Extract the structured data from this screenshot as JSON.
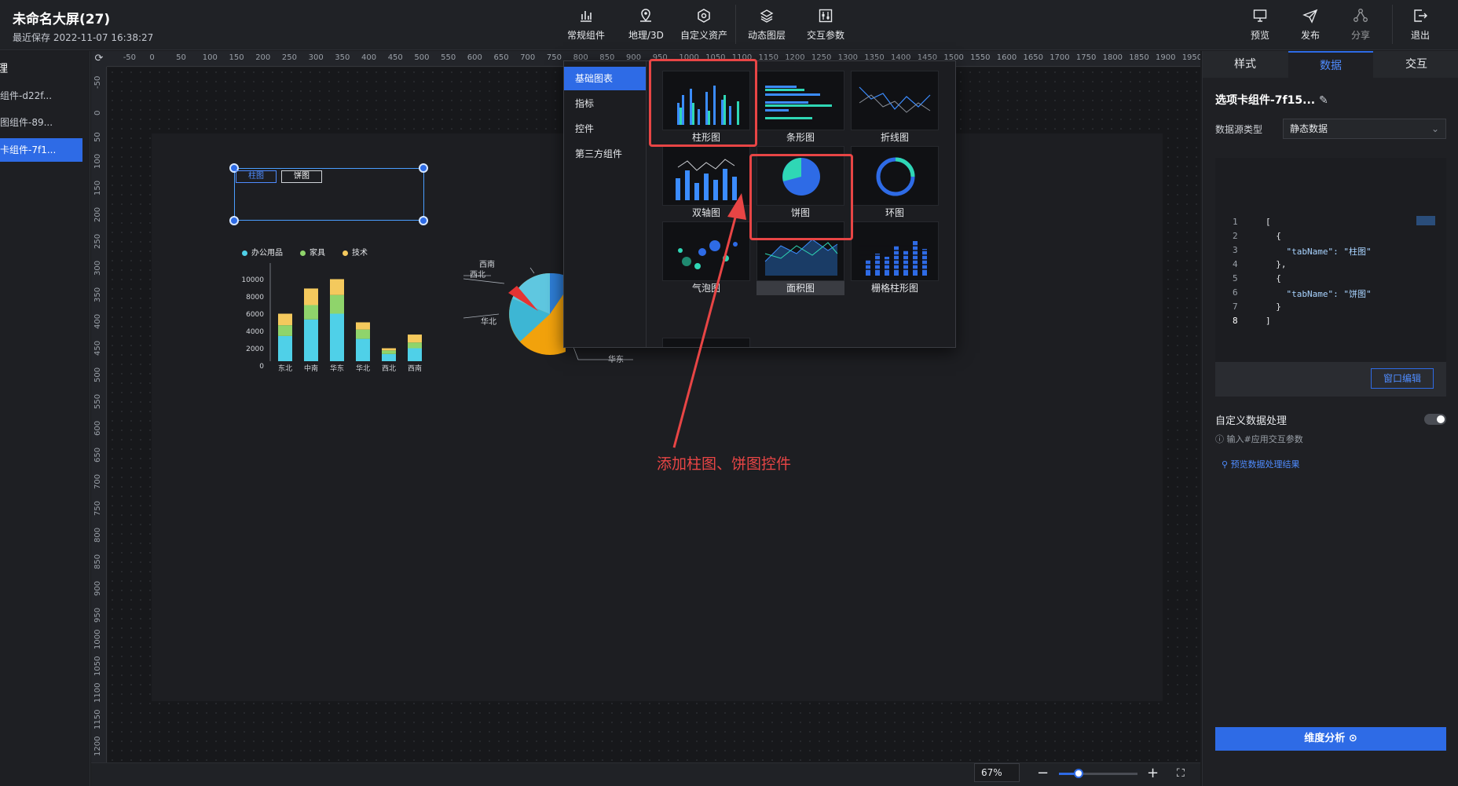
{
  "header": {
    "title": "未命名大屏(27)",
    "subtitle": "最近保存 2022-11-07 16:38:27",
    "tools": [
      {
        "label": "常规组件",
        "icon": "bar-chart-icon"
      },
      {
        "label": "地理/3D",
        "icon": "map-pin-icon"
      },
      {
        "label": "自定义资产",
        "icon": "hexagon-icon"
      },
      {
        "label": "动态图层",
        "icon": "layers-icon"
      },
      {
        "label": "交互参数",
        "icon": "sliders-icon"
      }
    ],
    "actions": [
      {
        "label": "预览",
        "icon": "monitor-icon"
      },
      {
        "label": "发布",
        "icon": "send-icon"
      },
      {
        "label": "分享",
        "icon": "share-icon"
      },
      {
        "label": "退出",
        "icon": "exit-icon"
      }
    ]
  },
  "layers": {
    "title": "理",
    "items": [
      "组件-d22f...",
      "图组件-89...",
      "卡组件-7f1..."
    ],
    "active_index": 2
  },
  "ruler": {
    "top": [
      "0",
      "-50",
      "0",
      "50",
      "100",
      "150",
      "200",
      "250",
      "300",
      "350",
      "400",
      "450",
      "500",
      "550",
      "600",
      "650",
      "700",
      "750",
      "800",
      "850",
      "900",
      "950",
      "1000",
      "1050",
      "1100",
      "1150",
      "1200",
      "1250",
      "1300",
      "1350",
      "1400",
      "1450",
      "1500",
      "1550",
      "1600",
      "1650",
      "1700",
      "1750",
      "1800",
      "1850",
      "1900",
      "1950"
    ],
    "left": [
      "-50",
      "0",
      "50",
      "100",
      "150",
      "200",
      "250",
      "300",
      "350",
      "400",
      "450",
      "500",
      "550",
      "600",
      "650",
      "700",
      "750",
      "800",
      "850",
      "900",
      "950",
      "1000",
      "1050",
      "1100",
      "1150",
      "1200"
    ]
  },
  "canvas": {
    "tabs": [
      "柱图",
      "饼图"
    ],
    "bar_chart": {
      "legend": [
        "办公用品",
        "家具",
        "技术"
      ],
      "y_ticks": [
        "10000",
        "8000",
        "6000",
        "4000",
        "2000",
        "0"
      ],
      "colors": [
        "#4fd0e8",
        "#8fd46b",
        "#f4c95d"
      ]
    },
    "pie_labels": [
      "西南",
      "西北",
      "华北",
      "华东"
    ]
  },
  "chart_data": {
    "type": "bar",
    "categories": [
      "东北",
      "中南",
      "华东",
      "华北",
      "西北",
      "西南"
    ],
    "series": [
      {
        "name": "办公用品",
        "values": [
          3500,
          5800,
          6600,
          3100,
          1000,
          1800
        ]
      },
      {
        "name": "家具",
        "values": [
          1500,
          2000,
          2600,
          1300,
          500,
          800
        ]
      },
      {
        "name": "技术",
        "values": [
          1600,
          2300,
          2200,
          1000,
          300,
          1100
        ]
      }
    ],
    "ylim": [
      0,
      12000
    ],
    "stacked": true
  },
  "popup": {
    "categories": [
      "基础图表",
      "指标",
      "控件",
      "第三方组件"
    ],
    "active_category": 0,
    "charts": [
      "柱形图",
      "条形图",
      "折线图",
      "双轴图",
      "饼图",
      "环图",
      "气泡图",
      "面积图",
      "栅格柱形图"
    ]
  },
  "annotation": "添加柱图、饼图控件",
  "right": {
    "tabs": [
      "样式",
      "数据",
      "交互"
    ],
    "active_tab": 1,
    "component_name": "选项卡组件-7f15...",
    "datasource_label": "数据源类型",
    "datasource_value": "静态数据",
    "code_lines": [
      "[",
      "  {",
      "    \"tabName\": \"柱图\"",
      "  },",
      "  {",
      "    \"tabName\": \"饼图\"",
      "  }",
      "]"
    ],
    "window_edit": "窗口编辑",
    "custom_title": "自定义数据处理",
    "custom_hint": "输入#应用交互参数",
    "preview_link": "预览数据处理结果",
    "dimension_button": "维度分析"
  },
  "bottom": {
    "zoom": "67%",
    "zoom_level": 0.25
  }
}
